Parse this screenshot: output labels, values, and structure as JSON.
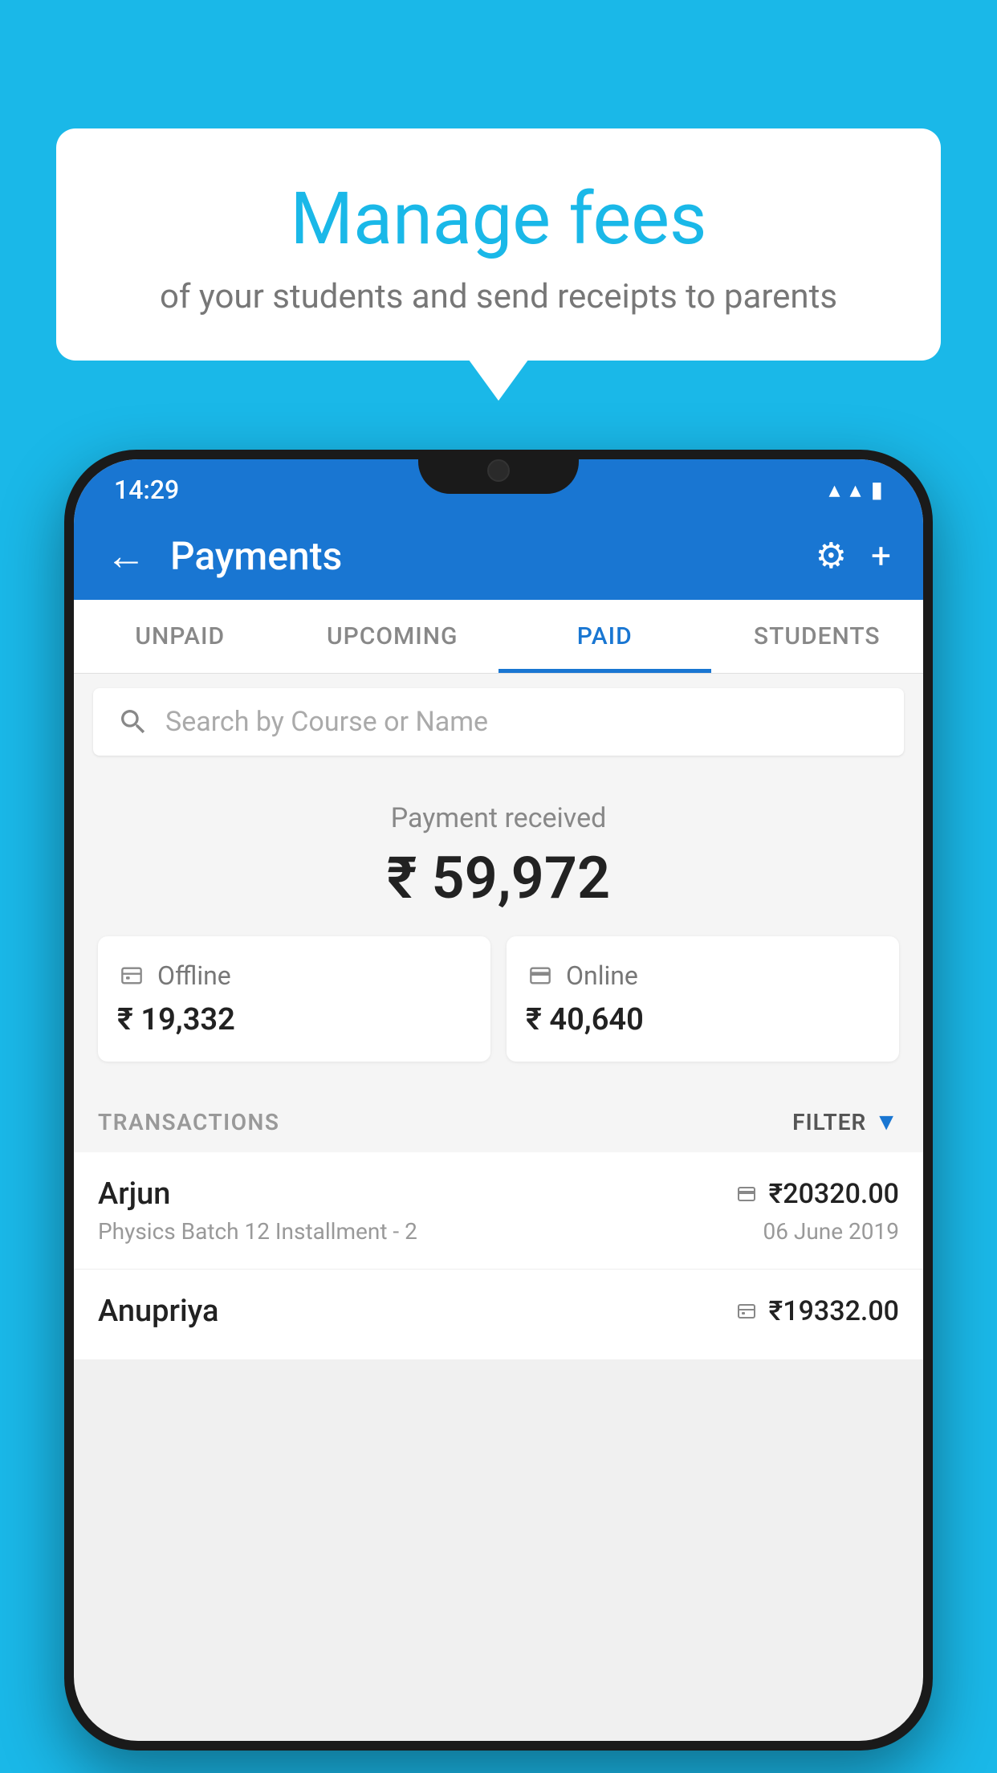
{
  "background_color": "#1ab8e8",
  "speech_bubble": {
    "title": "Manage fees",
    "subtitle": "of your students and send receipts to parents"
  },
  "status_bar": {
    "time": "14:29",
    "wifi_icon": "▼",
    "signal_icon": "▲",
    "battery_icon": "▌"
  },
  "app_bar": {
    "back_label": "←",
    "title": "Payments",
    "gear_label": "⚙",
    "plus_label": "+"
  },
  "tabs": [
    {
      "label": "UNPAID",
      "active": false
    },
    {
      "label": "UPCOMING",
      "active": false
    },
    {
      "label": "PAID",
      "active": true
    },
    {
      "label": "STUDENTS",
      "active": false
    }
  ],
  "search": {
    "placeholder": "Search by Course or Name"
  },
  "payment_summary": {
    "label": "Payment received",
    "amount": "₹ 59,972",
    "cards": [
      {
        "type": "offline",
        "label": "Offline",
        "amount": "₹ 19,332"
      },
      {
        "type": "online",
        "label": "Online",
        "amount": "₹ 40,640"
      }
    ]
  },
  "transactions_section": {
    "label": "TRANSACTIONS",
    "filter_label": "FILTER"
  },
  "transactions": [
    {
      "name": "Arjun",
      "detail": "Physics Batch 12 Installment - 2",
      "amount": "₹20320.00",
      "date": "06 June 2019",
      "payment_type": "online"
    },
    {
      "name": "Anupriya",
      "detail": "",
      "amount": "₹19332.00",
      "date": "",
      "payment_type": "offline"
    }
  ]
}
